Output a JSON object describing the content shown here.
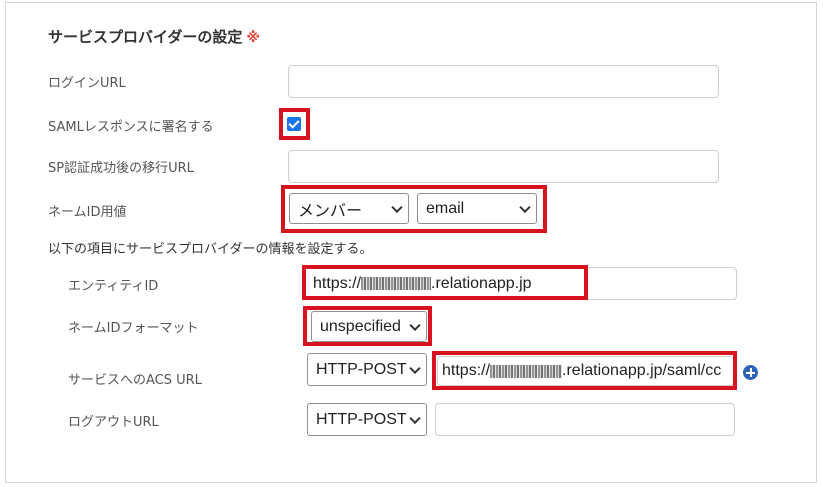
{
  "section": {
    "title": "サービスプロバイダーの設定",
    "required_mark": "※"
  },
  "fields": {
    "login_url": {
      "label": "ログインURL",
      "value": ""
    },
    "saml_sign": {
      "label": "SAMLレスポンスに署名する",
      "checked": true
    },
    "sp_redirect_url": {
      "label": "SP認証成功後の移行URL",
      "value": ""
    },
    "name_id_value": {
      "label": "ネームID用値",
      "select1": "メンバー",
      "select2": "email"
    }
  },
  "info_text": "以下の項目にサービスプロバイダーの情報を設定する。",
  "sp": {
    "entity_id": {
      "label": "エンティティID",
      "prefix": "https://",
      "suffix": ".relationapp.jp"
    },
    "name_id_format": {
      "label": "ネームIDフォーマット",
      "value": "unspecified"
    },
    "acs_url": {
      "label": "サービスへのACS URL",
      "method": "HTTP-POST",
      "prefix": "https://",
      "suffix": ".relationapp.jp/saml/cc"
    },
    "logout_url": {
      "label": "ログアウトURL",
      "method": "HTTP-POST",
      "value": ""
    }
  },
  "colors": {
    "highlight": "#d9121f",
    "required": "#e0443a",
    "checkbox": "#1a73e8",
    "plus_icon": "#2d63b8"
  }
}
